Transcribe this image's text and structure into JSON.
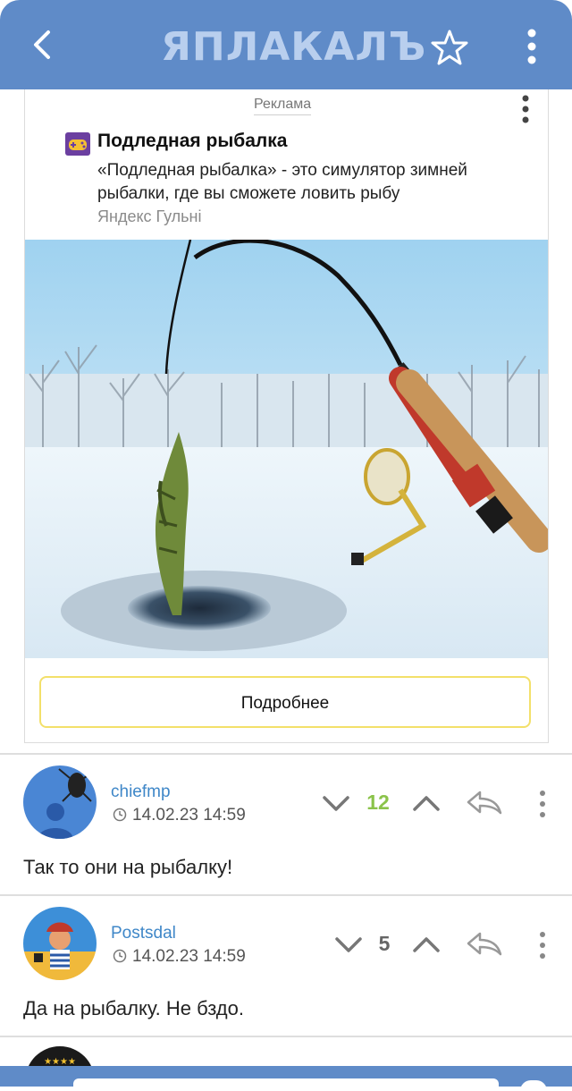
{
  "app": {
    "logo_text": "ЯПЛАКАЛЪ"
  },
  "ad": {
    "label": "Реклама",
    "title": "Подледная рыбалка",
    "description": "«Подледная рыбалка» - это симулятор зимней рыбалки, где вы сможете ловить рыбу",
    "source": "Яндекс Гульні",
    "button_label": "Подробнее"
  },
  "comments": [
    {
      "author": "chiefmp",
      "date": "14.02.23 14:59",
      "score": "12",
      "score_color": "#8bc34a",
      "text": "Так то они на рыбалку!"
    },
    {
      "author": "Postsdal",
      "date": "14.02.23 14:59",
      "score": "5",
      "score_color": "#666666",
      "text": "Да на рыбалку. Не бздо."
    }
  ],
  "colors": {
    "header": "#5f8bc8",
    "link": "#3f87c8",
    "button_border": "#f3e06a"
  }
}
